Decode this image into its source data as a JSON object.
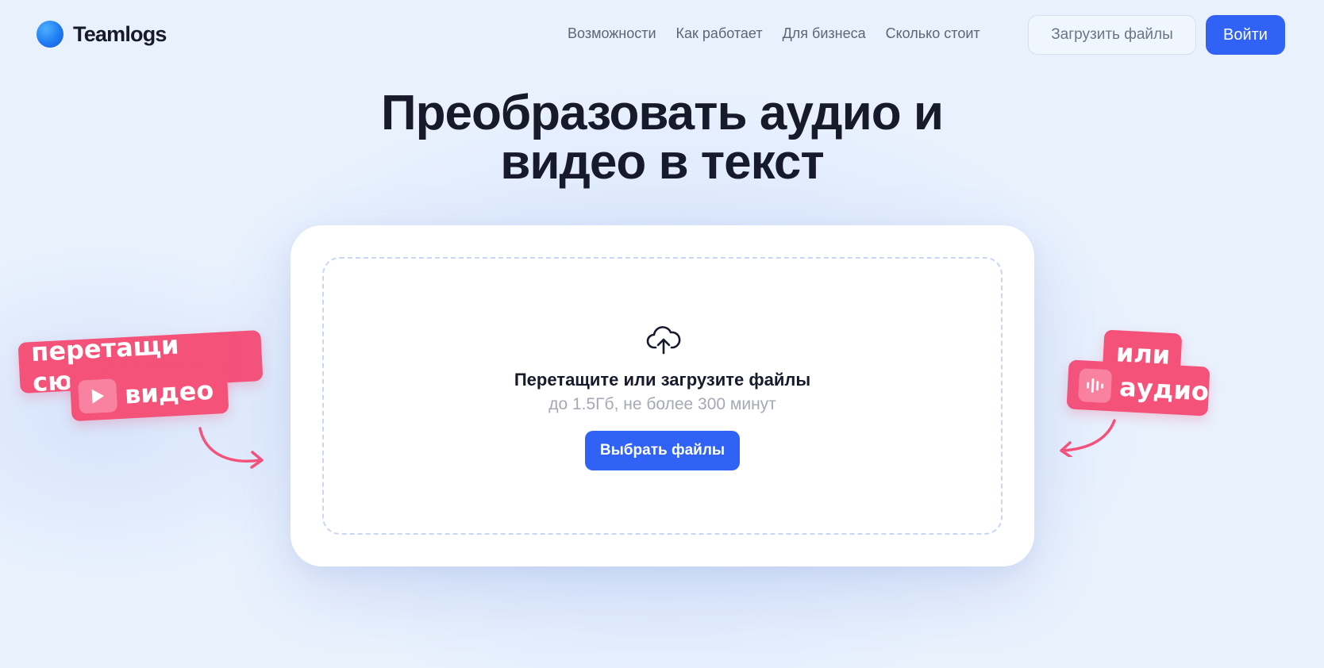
{
  "brand": {
    "name": "Teamlogs",
    "accent": "#2f62f5",
    "sticker_color": "#f5527a"
  },
  "nav": {
    "items": [
      "Возможности",
      "Как работает",
      "Для бизнеса",
      "Сколько стоит"
    ],
    "upload_label": "Загрузить файлы",
    "login_label": "Войти"
  },
  "hero": {
    "title_line1": "Преобразовать аудио и",
    "title_line2": "видео в текст"
  },
  "upload": {
    "icon": "cloud-upload-icon",
    "title": "Перетащите или загрузите файлы",
    "hint": "до 1.5Гб, не более 300 минут",
    "button_label": "Выбрать файлы"
  },
  "stickers": {
    "left_line1": "перетащи сюда",
    "left_line2": "видео",
    "right_line1": "или",
    "right_line2": "аудио"
  }
}
